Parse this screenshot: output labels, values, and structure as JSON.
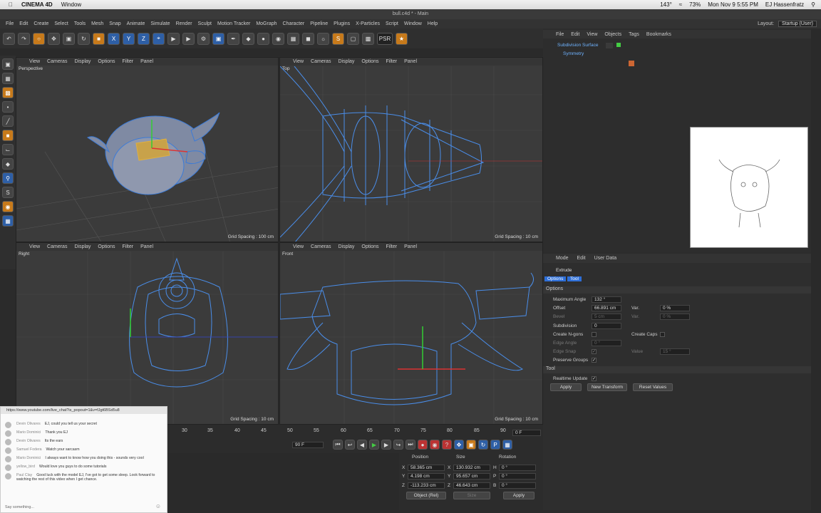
{
  "menubar": {
    "app": "CINEMA 4D",
    "menu_window": "Window",
    "status_temp": "143°",
    "battery": "73%",
    "clock": "Mon Nov 9  5:55 PM",
    "user": "EJ Hassenfratz"
  },
  "window_title": "bull.c4d * - Main",
  "app_menu": [
    "File",
    "Edit",
    "Create",
    "Select",
    "Tools",
    "Mesh",
    "Snap",
    "Animate",
    "Simulate",
    "Render",
    "Sculpt",
    "Motion Tracker",
    "MoGraph",
    "Character",
    "Pipeline",
    "Plugins",
    "X-Particles",
    "Script",
    "Window",
    "Help"
  ],
  "layout_label": "Layout:",
  "layout_value": "Startup (User)",
  "toolbar": {
    "x": "X",
    "y": "Y",
    "z": "Z",
    "psr": "PSR",
    "psr_val": "0"
  },
  "viewport_menu": [
    "View",
    "Cameras",
    "Display",
    "Options",
    "Filter",
    "Panel"
  ],
  "viewports": {
    "perspective": {
      "label": "Perspective",
      "grid": "Grid Spacing : 100 cm"
    },
    "top": {
      "label": "Top",
      "grid": "Grid Spacing : 10 cm"
    },
    "right": {
      "label": "Right",
      "grid": "Grid Spacing : 10 cm"
    },
    "front": {
      "label": "Front",
      "grid": "Grid Spacing : 10 cm"
    }
  },
  "objects": {
    "menu": [
      "File",
      "Edit",
      "View",
      "Objects",
      "Tags",
      "Bookmarks"
    ],
    "items": [
      "Subdivision Surface",
      "Symmetry"
    ]
  },
  "attributes": {
    "menu": [
      "Mode",
      "Edit",
      "User Data"
    ],
    "title": "Extrude",
    "tabs": [
      "Options",
      "Tool"
    ],
    "section_options": "Options",
    "max_angle_label": "Maximum Angle",
    "max_angle": "132 °",
    "offset_label": "Offset",
    "offset": "66.891 cm",
    "var_label": "Var.",
    "var": "0 %",
    "bevel_label": "Bevel",
    "bevel": "5 cm",
    "var2": "0 %",
    "subdivision_label": "Subdivision",
    "subdivision": "0",
    "ngons_label": "Create N-gons",
    "caps_label": "Create Caps",
    "edge_angle_label": "Edge Angle",
    "edge_angle": "0 °",
    "edge_snap_label": "Edge Snap",
    "value_label": "Value",
    "value": "15 °",
    "preserve_label": "Preserve Groups",
    "section_tool": "Tool",
    "realtime_label": "Realtime Update",
    "apply": "Apply",
    "new_transform": "New Transform",
    "reset_values": "Reset Values"
  },
  "timeline": {
    "ticks": [
      "30",
      "35",
      "40",
      "45",
      "50",
      "55",
      "60",
      "65",
      "70",
      "75",
      "80",
      "85",
      "90"
    ],
    "frame_end": "90 F",
    "frame_cur": "0 F"
  },
  "coords": {
    "h_position": "Position",
    "h_size": "Size",
    "h_rotation": "Rotation",
    "x_pos": "58.365 cm",
    "x_size": "130.932 cm",
    "h_rot": "0 °",
    "y_pos": "4.198 cm",
    "y_size": "95.657 cm",
    "p_rot": "0 °",
    "z_pos": "-113.233 cm",
    "z_size": "46.643 cm",
    "b_rot": "0 °",
    "mode": "Object (Rel)",
    "size_mode": "Size",
    "apply": "Apply"
  },
  "chat": {
    "url": "https://www.youtube.com/live_chat?is_popout=1&v=fJgt6BSd5u8",
    "messages": [
      {
        "who": "Devin Olivares",
        "text": "EJ, could you tell us your secret"
      },
      {
        "who": "Mario Dominici",
        "text": "Thank you EJ"
      },
      {
        "who": "Devin Olivares",
        "text": "Its the ears"
      },
      {
        "who": "Samuel Fodera",
        "text": "Watch your sarcasm"
      },
      {
        "who": "Mario Dominici",
        "text": "I always want to know how you doing this - sounds very cool"
      },
      {
        "who": "yellow_bird",
        "text": "Would love you guys to do some tutorials"
      },
      {
        "who": "Paul Clay",
        "text": "Good luck with the model EJ, I've got to get some sleep. Look forward to watching the rest of this video when I get chance."
      }
    ],
    "input_label": "Say something..."
  }
}
